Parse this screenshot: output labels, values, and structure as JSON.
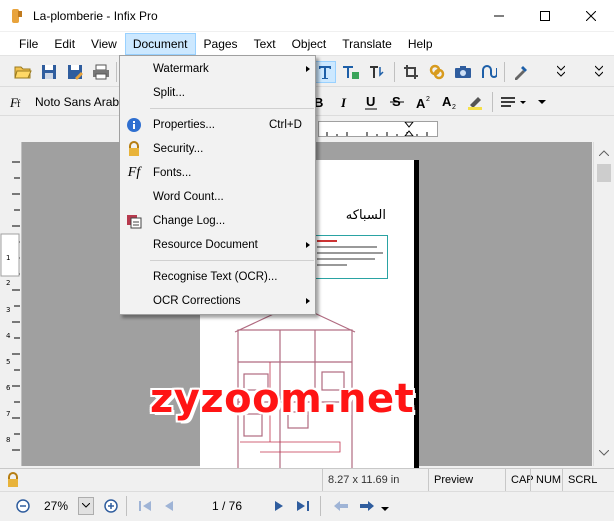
{
  "window": {
    "title": "La-plomberie - Infix Pro",
    "controls": [
      "minimize",
      "maximize",
      "close"
    ]
  },
  "menubar": {
    "items": [
      {
        "label": "File"
      },
      {
        "label": "Edit"
      },
      {
        "label": "View"
      },
      {
        "label": "Document",
        "active": true
      },
      {
        "label": "Pages"
      },
      {
        "label": "Text"
      },
      {
        "label": "Object"
      },
      {
        "label": "Translate"
      },
      {
        "label": "Help"
      }
    ]
  },
  "format_toolbar": {
    "font_name": "Noto Sans Arabic"
  },
  "document_menu": {
    "items": [
      {
        "label": "Watermark",
        "submenu": true
      },
      {
        "label": "Split..."
      },
      {
        "label": "Properties...",
        "shortcut": "Ctrl+D",
        "icon": "info-icon"
      },
      {
        "label": "Security...",
        "icon": "lock-icon"
      },
      {
        "label": "Fonts...",
        "icon": "fonts-icon",
        "icon_text": "Ff"
      },
      {
        "label": "Word Count..."
      },
      {
        "label": "Change Log...",
        "icon": "change-log-icon"
      },
      {
        "label": "Resource Document",
        "submenu": true
      },
      {
        "label": "Recognise Text (OCR)..."
      },
      {
        "label": "OCR Corrections",
        "submenu": true
      }
    ]
  },
  "page": {
    "heading": "السباكه"
  },
  "overlay": {
    "watermark": "zyzoom.net"
  },
  "statusbar": {
    "page_size": "8.27 x 11.69 in",
    "mode": "Preview",
    "cap": "CAP",
    "num": "NUM",
    "scrl": "SCRL"
  },
  "navbar": {
    "zoom": "27%",
    "page_indicator": "1 / 76"
  },
  "colors": {
    "menu_highlight": "#cce8ff",
    "watermark_red": "#ff1414",
    "canvas_gray": "#a0a0a0"
  }
}
